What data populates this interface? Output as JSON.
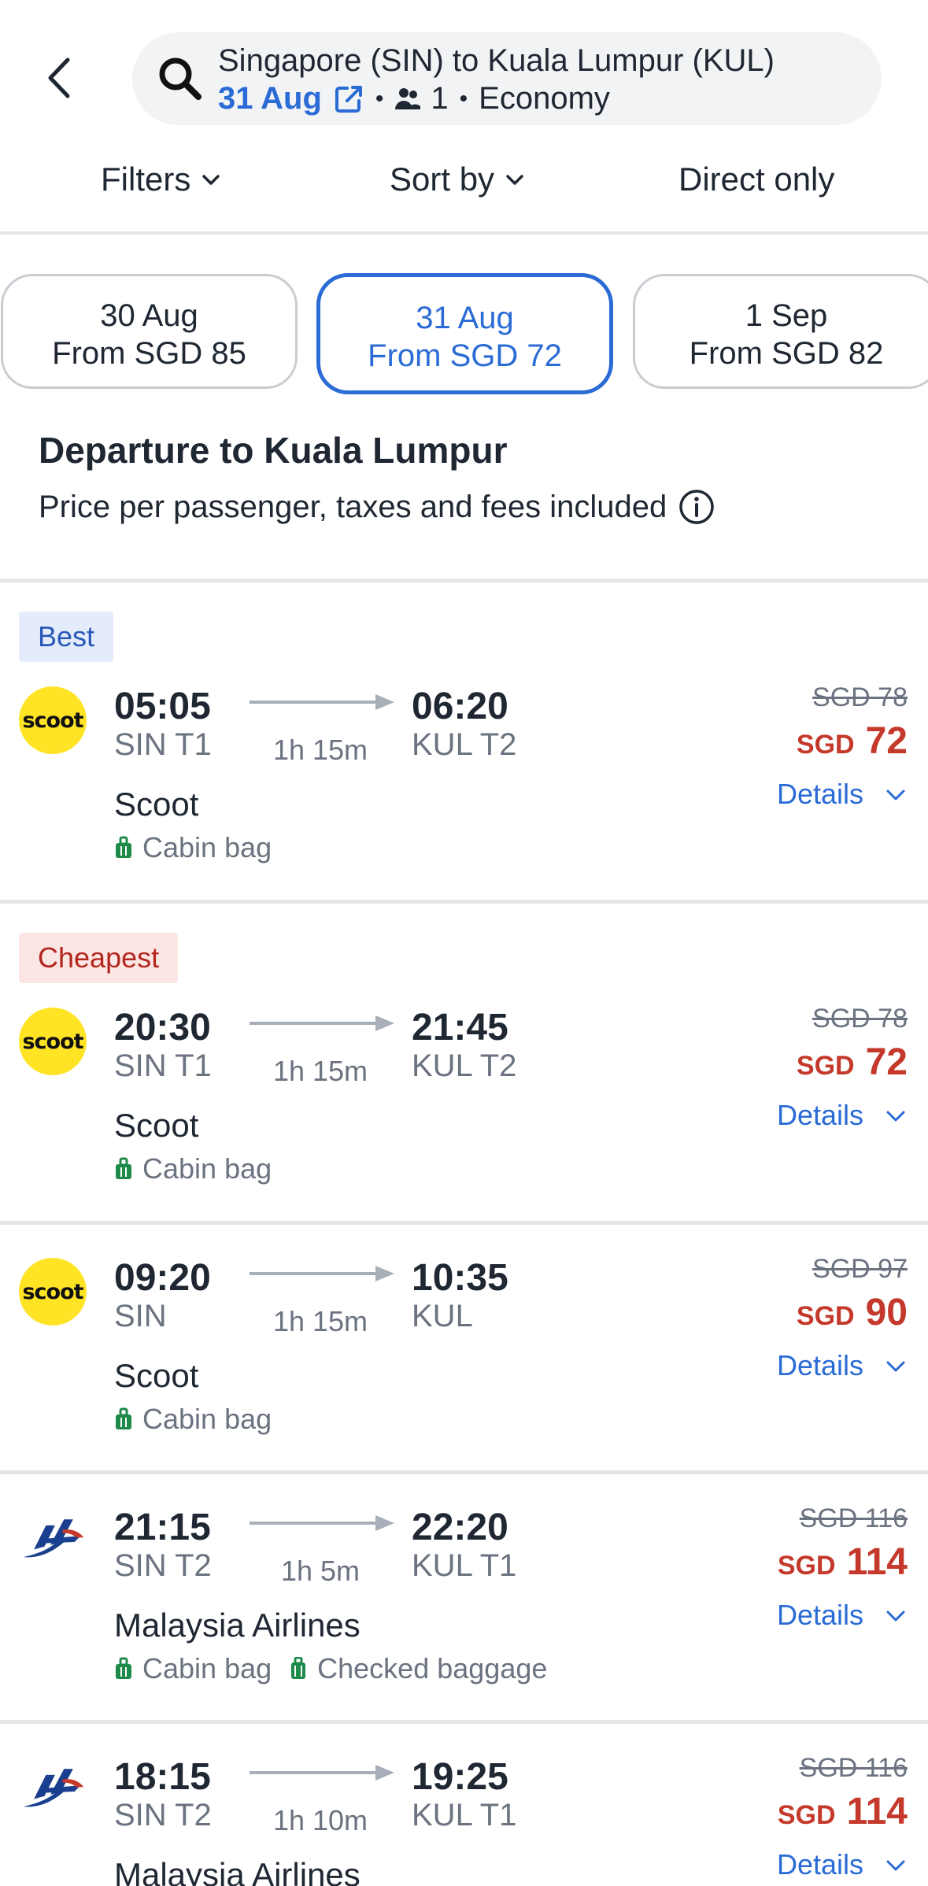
{
  "header": {
    "route": "Singapore (SIN) to Kuala Lumpur (KUL)",
    "date": "31 Aug",
    "passengers": "1",
    "cabin": "Economy"
  },
  "filters": {
    "filters_label": "Filters",
    "sort_label": "Sort by",
    "direct_label": "Direct only"
  },
  "date_chips": [
    {
      "date": "30 Aug",
      "price": "From SGD 85"
    },
    {
      "date": "31 Aug",
      "price": "From SGD 72"
    },
    {
      "date": "1 Sep",
      "price": "From SGD 82"
    }
  ],
  "section": {
    "title": "Departure to Kuala Lumpur",
    "subtitle": "Price per passenger, taxes and fees included"
  },
  "flights": [
    {
      "badge": "Best",
      "logo_text": "scoot",
      "dep_time": "05:05",
      "dep_code": "SIN T1",
      "duration": "1h 15m",
      "arr_time": "06:20",
      "arr_code": "KUL T2",
      "airline": "Scoot",
      "bag1": "Cabin bag",
      "bag2": "",
      "old_price": "SGD 78",
      "currency": "SGD",
      "price": "72",
      "details": "Details"
    },
    {
      "badge": "Cheapest",
      "logo_text": "scoot",
      "dep_time": "20:30",
      "dep_code": "SIN T1",
      "duration": "1h 15m",
      "arr_time": "21:45",
      "arr_code": "KUL T2",
      "airline": "Scoot",
      "bag1": "Cabin bag",
      "bag2": "",
      "old_price": "SGD 78",
      "currency": "SGD",
      "price": "72",
      "details": "Details"
    },
    {
      "badge": "",
      "logo_text": "scoot",
      "dep_time": "09:20",
      "dep_code": "SIN",
      "duration": "1h 15m",
      "arr_time": "10:35",
      "arr_code": "KUL",
      "airline": "Scoot",
      "bag1": "Cabin bag",
      "bag2": "",
      "old_price": "SGD 97",
      "currency": "SGD",
      "price": "90",
      "details": "Details"
    },
    {
      "badge": "",
      "logo_text": "",
      "dep_time": "21:15",
      "dep_code": "SIN T2",
      "duration": "1h 5m",
      "arr_time": "22:20",
      "arr_code": "KUL T1",
      "airline": "Malaysia Airlines",
      "bag1": "Cabin bag",
      "bag2": "Checked baggage",
      "old_price": "SGD 116",
      "currency": "SGD",
      "price": "114",
      "details": "Details"
    },
    {
      "badge": "",
      "logo_text": "",
      "dep_time": "18:15",
      "dep_code": "SIN T2",
      "duration": "1h 10m",
      "arr_time": "19:25",
      "arr_code": "KUL T1",
      "airline": "Malaysia Airlines",
      "bag1": "",
      "bag2": "",
      "old_price": "SGD 116",
      "currency": "SGD",
      "price": "114",
      "details": "Details"
    }
  ],
  "colors": {
    "accent": "#2a6bd6",
    "price_red": "#c4392b",
    "scoot_yellow": "#ffe426",
    "mas_blue": "#1a3f8f",
    "bag_green": "#1e8a4a"
  }
}
